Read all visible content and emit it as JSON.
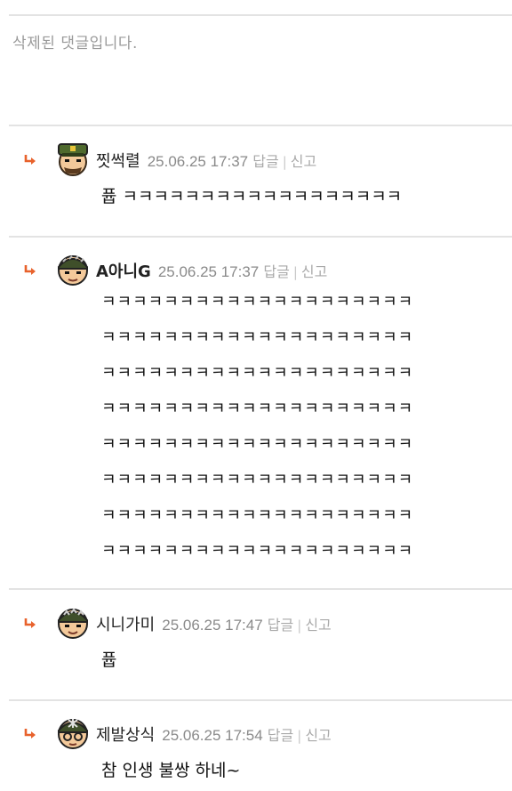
{
  "deleted_notice": "삭제된 댓글입니다.",
  "actions": {
    "reply": "답글",
    "report": "신고",
    "separator": "|"
  },
  "comments": [
    {
      "nickname": "찟썩렬",
      "timestamp": "25.06.25 17:37",
      "text": "퓹 ㅋㅋㅋㅋㅋㅋㅋㅋㅋㅋㅋㅋㅋㅋㅋㅋㅋㅋ"
    },
    {
      "nickname": "A아니G",
      "timestamp": "25.06.25 17:37",
      "lines": [
        "ㅋㅋㅋㅋㅋㅋㅋㅋㅋㅋㅋㅋㅋㅋㅋㅋㅋㅋㅋㅋ",
        "ㅋㅋㅋㅋㅋㅋㅋㅋㅋㅋㅋㅋㅋㅋㅋㅋㅋㅋㅋㅋ",
        "ㅋㅋㅋㅋㅋㅋㅋㅋㅋㅋㅋㅋㅋㅋㅋㅋㅋㅋㅋㅋ",
        "ㅋㅋㅋㅋㅋㅋㅋㅋㅋㅋㅋㅋㅋㅋㅋㅋㅋㅋㅋㅋ",
        "ㅋㅋㅋㅋㅋㅋㅋㅋㅋㅋㅋㅋㅋㅋㅋㅋㅋㅋㅋㅋ",
        "ㅋㅋㅋㅋㅋㅋㅋㅋㅋㅋㅋㅋㅋㅋㅋㅋㅋㅋㅋㅋ",
        "ㅋㅋㅋㅋㅋㅋㅋㅋㅋㅋㅋㅋㅋㅋㅋㅋㅋㅋㅋㅋ",
        "ㅋㅋㅋㅋㅋㅋㅋㅋㅋㅋㅋㅋㅋㅋㅋㅋㅋㅋㅋㅋ"
      ]
    },
    {
      "nickname": "시니가미",
      "timestamp": "25.06.25 17:47",
      "text": "퓹"
    },
    {
      "nickname": "제발상식",
      "timestamp": "25.06.25 17:54",
      "text": "참 인생 불쌍 하네~"
    }
  ],
  "colors": {
    "reply_arrow": "#e8622c",
    "divider": "#e3e3e3",
    "meta": "#8a8a8a"
  }
}
